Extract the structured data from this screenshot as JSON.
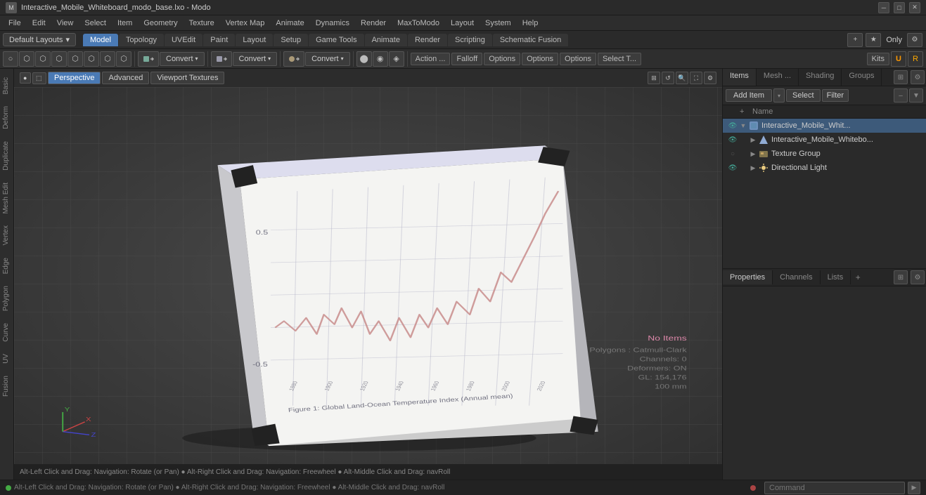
{
  "titlebar": {
    "title": "Interactive_Mobile_Whiteboard_modo_base.lxo - Modo",
    "icon": "🎨",
    "controls": [
      "–",
      "□",
      "×"
    ]
  },
  "menubar": {
    "items": [
      "File",
      "Edit",
      "View",
      "Select",
      "Item",
      "Geometry",
      "Texture",
      "Vertex Map",
      "Animate",
      "Dynamics",
      "Render",
      "MaxToModo",
      "Layout",
      "System",
      "Help"
    ]
  },
  "modebar": {
    "layouts_label": "Default Layouts",
    "tabs": [
      "Model",
      "Topology",
      "UVEdit",
      "Paint",
      "Layout",
      "Setup",
      "Game Tools",
      "Animate",
      "Render",
      "Scripting",
      "Schematic Fusion"
    ],
    "active_tab": "Model",
    "add_icon": "+",
    "star_label": "Only"
  },
  "toolbar": {
    "convert_buttons": [
      "Convert",
      "Convert",
      "Convert"
    ],
    "action_label": "Action ...",
    "falloff_label": "Falloff",
    "options_buttons": [
      "Options",
      "Options",
      "Options"
    ],
    "select_t_label": "Select T...",
    "kits_label": "Kits"
  },
  "left_sidebar": {
    "tabs": [
      "Basic",
      "Deform",
      "Duplicate",
      "Mesh Edit",
      "Vertex",
      "Edge",
      "Polygon",
      "Curve",
      "UV",
      "Fusion"
    ]
  },
  "viewport": {
    "header": {
      "perspective": "Perspective",
      "advanced": "Advanced",
      "viewport_textures": "Viewport Textures"
    },
    "statusbar": "Alt-Left Click and Drag: Navigation: Rotate (or Pan) ● Alt-Right Click and Drag: Navigation: Freewheel ● Alt-Middle Click and Drag: navRoll",
    "info": {
      "no_items": "No Items",
      "polygons": "Polygons : Catmull-Clark",
      "channels": "Channels: 0",
      "deformers": "Deformers: ON",
      "gl": "GL: 154,176",
      "size": "100 mm"
    }
  },
  "right_panel": {
    "items_tabs": [
      "Items",
      "Mesh ...",
      "Shading",
      "Groups"
    ],
    "active_items_tab": "Items",
    "toolbar": {
      "add_item": "Add Item",
      "select": "Select",
      "filter": "Filter"
    },
    "header_cols": {
      "name": "Name"
    },
    "items": [
      {
        "level": 0,
        "name": "Interactive_Mobile_Whit...",
        "icon": "📦",
        "has_eye": true,
        "expanded": true,
        "selected": true
      },
      {
        "level": 1,
        "name": "Interactive_Mobile_Whitebo...",
        "icon": "🔷",
        "has_eye": true,
        "expanded": false
      },
      {
        "level": 1,
        "name": "Texture Group",
        "icon": "📁",
        "has_eye": false,
        "expanded": false
      },
      {
        "level": 1,
        "name": "Directional Light",
        "icon": "💡",
        "has_eye": true,
        "expanded": false
      }
    ],
    "properties_tabs": [
      "Properties",
      "Channels",
      "Lists"
    ],
    "active_properties_tab": "Properties"
  },
  "statusbar": {
    "message": "Alt-Left Click and Drag: Navigation: Rotate (or Pan) ● Alt-Right Click and Drag: Navigation: Freewheel ● Alt-Middle Click and Drag: navRoll",
    "command_placeholder": "Command",
    "dot1": "green",
    "dot2": "red"
  },
  "colors": {
    "accent_blue": "#4a7ab5",
    "active_green": "#4a9",
    "no_items_pink": "#dd88aa",
    "grid": "rgba(100,100,100,0.3)"
  }
}
